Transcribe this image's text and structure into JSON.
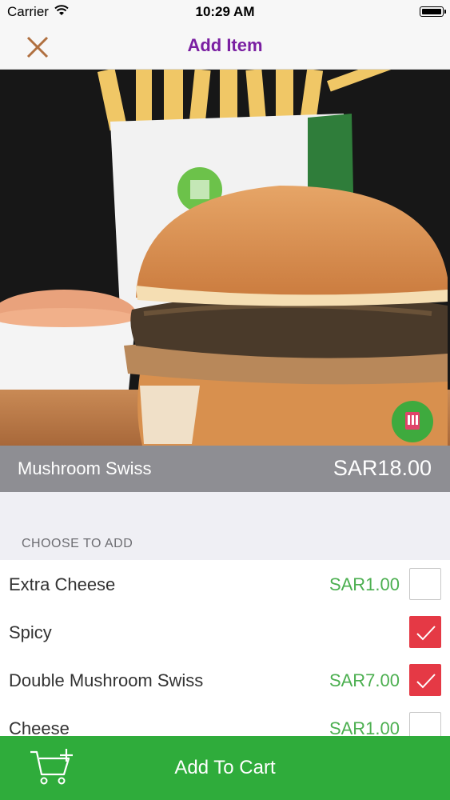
{
  "status_bar": {
    "carrier": "Carrier",
    "time": "10:29 AM"
  },
  "nav": {
    "title": "Add Item",
    "close_icon": "close-x-icon",
    "accent_color": "#7a1fa2",
    "close_color": "#b07040"
  },
  "item": {
    "name": "Mushroom Swiss",
    "price": "SAR18.00",
    "image": "burger-with-fries-photo"
  },
  "options_section": {
    "header": "CHOOSE TO ADD",
    "items": [
      {
        "label": "Extra Cheese",
        "price": "SAR1.00",
        "checked": false
      },
      {
        "label": "Spicy",
        "price": "",
        "checked": true
      },
      {
        "label": "Double Mushroom Swiss",
        "price": "SAR7.00",
        "checked": true
      },
      {
        "label": "Cheese",
        "price": "SAR1.00",
        "checked": false
      }
    ]
  },
  "cart_button": {
    "label": "Add To Cart",
    "icon": "cart-plus-icon",
    "color": "#2fac3b"
  },
  "colors": {
    "price_green": "#4caf50",
    "checkbox_red": "#e53945"
  }
}
